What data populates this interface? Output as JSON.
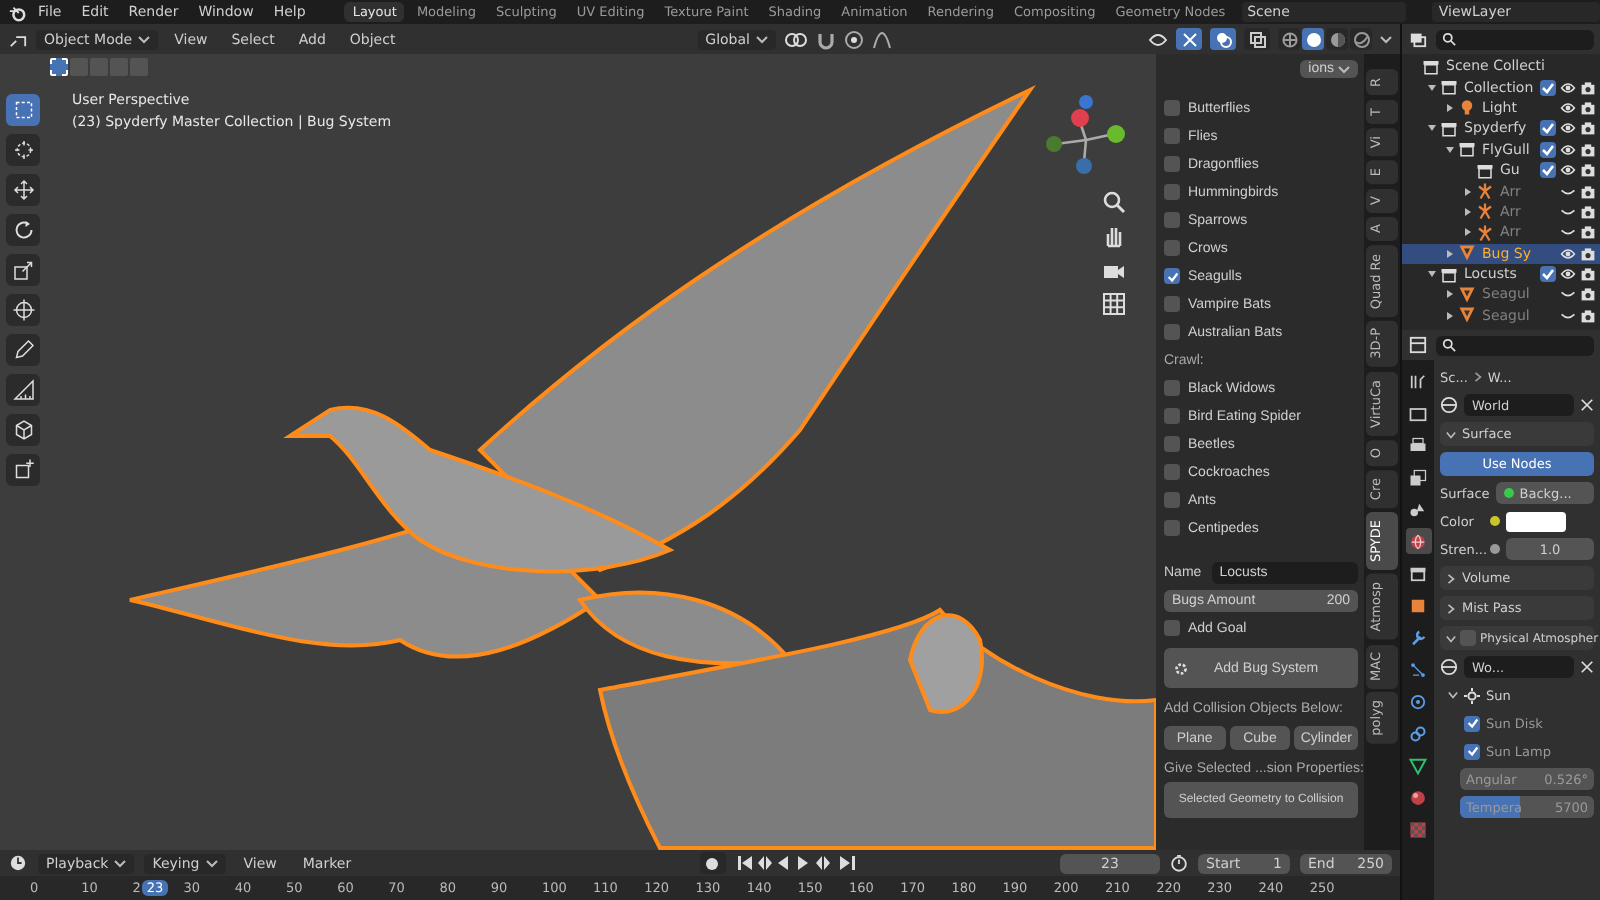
{
  "menu": {
    "items": [
      "File",
      "Edit",
      "Render",
      "Window",
      "Help"
    ]
  },
  "workspaces": [
    {
      "label": "Layout",
      "selected": true
    },
    {
      "label": "Modeling",
      "selected": false
    },
    {
      "label": "Sculpting",
      "selected": false
    },
    {
      "label": "UV Editing",
      "selected": false
    },
    {
      "label": "Texture Paint",
      "selected": false
    },
    {
      "label": "Shading",
      "selected": false
    },
    {
      "label": "Animation",
      "selected": false
    },
    {
      "label": "Rendering",
      "selected": false
    },
    {
      "label": "Compositing",
      "selected": false
    },
    {
      "label": "Geometry Nodes",
      "selected": false
    }
  ],
  "scene": {
    "value": "Scene"
  },
  "view_layer": {
    "value": "ViewLayer"
  },
  "viewport_header": {
    "mode": "Object Mode",
    "menus": [
      "View",
      "Select",
      "Add",
      "Object"
    ],
    "orientation": "Global",
    "shading_modes": [
      {
        "kind": "wireframe",
        "selected": false
      },
      {
        "kind": "solid",
        "selected": true
      },
      {
        "kind": "material",
        "selected": false
      },
      {
        "kind": "rendered",
        "selected": false
      }
    ]
  },
  "select_modes": [
    {
      "selected": true
    },
    {
      "selected": false
    },
    {
      "selected": false
    },
    {
      "selected": false
    },
    {
      "selected": false
    }
  ],
  "tools": [
    {
      "kind": "select_box",
      "selected": true
    },
    {
      "kind": "cursor",
      "selected": false
    },
    {
      "kind": "move",
      "selected": false
    },
    {
      "kind": "rotate",
      "selected": false
    },
    {
      "kind": "scale",
      "selected": false
    },
    {
      "kind": "transform",
      "selected": false
    },
    {
      "kind": "annotate",
      "selected": false
    },
    {
      "kind": "measure",
      "selected": false
    },
    {
      "kind": "add_cube",
      "selected": false
    },
    {
      "kind": "add_object",
      "selected": false
    }
  ],
  "viewport": {
    "perspective": "User Perspective",
    "collection_info": "(23) Spyderfy Master Collection | Bug System"
  },
  "bug_panel": {
    "options": "ions",
    "fly": [
      {
        "label": "Butterflies",
        "checked": false
      },
      {
        "label": "Flies",
        "checked": false
      },
      {
        "label": "Dragonflies",
        "checked": false
      },
      {
        "label": "Hummingbirds",
        "checked": false
      },
      {
        "label": "Sparrows",
        "checked": false
      },
      {
        "label": "Crows",
        "checked": false
      },
      {
        "label": "Seagulls",
        "checked": true
      },
      {
        "label": "Vampire Bats",
        "checked": false
      },
      {
        "label": "Australian Bats",
        "checked": false
      }
    ],
    "crawl_heading": "Crawl:",
    "crawl": [
      {
        "label": "Black Widows",
        "checked": false
      },
      {
        "label": "Bird Eating Spider",
        "checked": false
      },
      {
        "label": "Beetles",
        "checked": false
      },
      {
        "label": "Cockroaches",
        "checked": false
      },
      {
        "label": "Ants",
        "checked": false
      },
      {
        "label": "Centipedes",
        "checked": false
      }
    ],
    "name_label": "Name",
    "name_value": "Locusts",
    "amount_label": "Bugs Amount",
    "amount_value": "200",
    "add_goal": {
      "label": "Add Goal",
      "checked": false
    },
    "add_button": "Add Bug System",
    "collision_heading": "Add Collision Objects Below:",
    "collision_buttons": [
      "Plane",
      "Cube",
      "Cylinder"
    ],
    "give_heading": "Give Selected ...sion Properties:",
    "give_button": "Selected Geometry to Collision"
  },
  "sidebar_tabs": [
    {
      "label": "R",
      "selected": false
    },
    {
      "label": "T",
      "selected": false
    },
    {
      "label": "Vi",
      "selected": false
    },
    {
      "label": "E",
      "selected": false
    },
    {
      "label": "V",
      "selected": false
    },
    {
      "label": "A",
      "selected": false
    },
    {
      "label": "Quad Re",
      "selected": false
    },
    {
      "label": "3D-P",
      "selected": false
    },
    {
      "label": "VirtuCa",
      "selected": false
    },
    {
      "label": "O",
      "selected": false
    },
    {
      "label": "Cre",
      "selected": false
    },
    {
      "label": "SPYDE",
      "selected": true
    },
    {
      "label": "Atmosp",
      "selected": false
    },
    {
      "label": "MAC",
      "selected": false
    },
    {
      "label": "polyg",
      "selected": false
    }
  ],
  "outliner": {
    "rows": [
      {
        "label": "Scene Collecti",
        "kind": "scene_collection",
        "selected": false,
        "children": [
          {
            "label": "Collection",
            "kind": "collection",
            "expanded": true,
            "checked": true,
            "visible": true,
            "selected": false,
            "children": [
              {
                "label": "Light",
                "kind": "light",
                "expanded": false,
                "visible": true,
                "selected": false
              }
            ]
          },
          {
            "label": "Spyderfy",
            "kind": "collection",
            "expanded": true,
            "checked": true,
            "visible": true,
            "selected": false,
            "children": [
              {
                "label": "FlyGull",
                "kind": "collection",
                "expanded": true,
                "checked": true,
                "visible": true,
                "selected": false,
                "children": [
                  {
                    "label": "Gu",
                    "kind": "collection",
                    "checked": true,
                    "visible": true,
                    "selected": false
                  },
                  {
                    "label": "Arr",
                    "kind": "armature",
                    "expanded": false,
                    "visible": false,
                    "selected": false
                  },
                  {
                    "label": "Arr",
                    "kind": "armature",
                    "expanded": false,
                    "visible": false,
                    "selected": false
                  },
                  {
                    "label": "Arr",
                    "kind": "armature",
                    "expanded": false,
                    "visible": false,
                    "selected": false
                  }
                ]
              },
              {
                "label": "Bug Sy",
                "kind": "particles",
                "expanded": false,
                "visible": true,
                "selected": true
              }
            ]
          },
          {
            "label": "Locusts",
            "kind": "collection",
            "expanded": true,
            "checked": true,
            "visible": true,
            "selected": false,
            "children": [
              {
                "label": "Seagul",
                "kind": "particles",
                "expanded": false,
                "visible": false,
                "selected": false
              },
              {
                "label": "Seagul",
                "kind": "particles",
                "expanded": false,
                "visible": false,
                "selected": false
              }
            ]
          }
        ]
      }
    ]
  },
  "properties": {
    "tabs": [
      {
        "kind": "tool",
        "selected": false
      },
      {
        "kind": "render",
        "selected": false
      },
      {
        "kind": "output",
        "selected": false
      },
      {
        "kind": "view_layer",
        "selected": false
      },
      {
        "kind": "scene",
        "selected": false
      },
      {
        "kind": "world",
        "selected": true
      },
      {
        "kind": "collection",
        "selected": false
      },
      {
        "kind": "object",
        "selected": false
      },
      {
        "kind": "modifier",
        "selected": false
      },
      {
        "kind": "particles",
        "selected": false
      },
      {
        "kind": "physics",
        "selected": false
      },
      {
        "kind": "constraints",
        "selected": false
      },
      {
        "kind": "data",
        "selected": false
      },
      {
        "kind": "material",
        "selected": false
      },
      {
        "kind": "texture",
        "selected": false
      }
    ],
    "breadcrumb": [
      "Sc...",
      "W..."
    ],
    "world_block": "World",
    "surface_panel": {
      "title": "Surface",
      "expanded": true
    },
    "use_nodes": "Use Nodes",
    "surface_label": "Surface",
    "surface_value": "Backg...",
    "color_label": "Color",
    "strength_label": "Stren...",
    "strength_value": "1.0",
    "collapsed_panels": [
      {
        "title": "Volume",
        "expanded": false
      },
      {
        "title": "Mist Pass",
        "expanded": false
      }
    ],
    "atmosphere": {
      "title": "Physical Atmospher",
      "expanded": true,
      "checked": false
    },
    "atmo_block": "Wo...",
    "sun": {
      "title": "Sun",
      "expanded": true
    },
    "options": [
      {
        "label": "Sun Disk",
        "checked": true
      },
      {
        "label": "Sun Lamp",
        "checked": true
      }
    ],
    "sliders": [
      {
        "label": "Angular",
        "value": "0.526°",
        "level": 0
      },
      {
        "label": "Tempera",
        "value": "5700",
        "level": 0.45
      }
    ]
  },
  "timeline": {
    "menus": [
      "Playback",
      "Keying"
    ],
    "plain_menus": [
      "View",
      "Marker"
    ],
    "current_frame": "23",
    "start_label": "Start",
    "start": "1",
    "end_label": "End",
    "end": "250",
    "ticks": [
      {
        "label": "0"
      },
      {
        "label": "10"
      },
      {
        "label": "2",
        "playhead": "23"
      },
      {
        "label": "30"
      },
      {
        "label": "40"
      },
      {
        "label": "50"
      },
      {
        "label": "60"
      },
      {
        "label": "70"
      },
      {
        "label": "80"
      },
      {
        "label": "90"
      },
      {
        "label": "100"
      },
      {
        "label": "110"
      },
      {
        "label": "120"
      },
      {
        "label": "130"
      },
      {
        "label": "140"
      },
      {
        "label": "150"
      },
      {
        "label": "160"
      },
      {
        "label": "170"
      },
      {
        "label": "180"
      },
      {
        "label": "190"
      },
      {
        "label": "200"
      },
      {
        "label": "210"
      },
      {
        "label": "220"
      },
      {
        "label": "230"
      },
      {
        "label": "240"
      },
      {
        "label": "250"
      }
    ]
  }
}
